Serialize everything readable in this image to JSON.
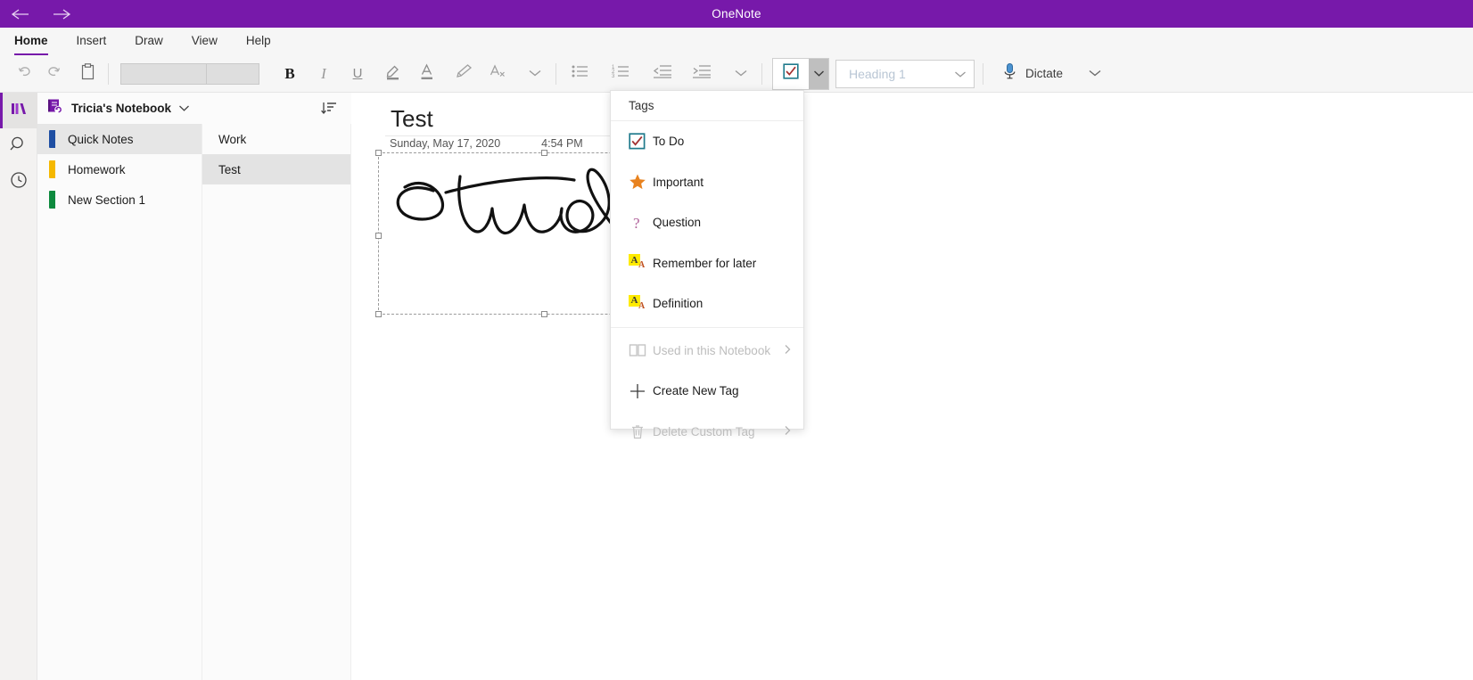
{
  "titlebar": {
    "app_title": "OneNote",
    "back_icon": "back-arrow-icon",
    "forward_icon": "forward-arrow-icon",
    "background": "#7719aa"
  },
  "ribbon": {
    "tabs": [
      {
        "label": "Home",
        "active": true
      },
      {
        "label": "Insert",
        "active": false
      },
      {
        "label": "Draw",
        "active": false
      },
      {
        "label": "View",
        "active": false
      },
      {
        "label": "Help",
        "active": false
      }
    ],
    "accent": "#7719aa"
  },
  "toolbar": {
    "undo_icon": "undo-icon",
    "redo_icon": "redo-icon",
    "clipboard_icon": "clipboard-icon",
    "font_name": "",
    "font_size": "",
    "bold_label": "B",
    "italic_label": "I",
    "underline_label": "U",
    "highlight_icon": "highlight-pen-icon",
    "font_color_icon": "font-color-icon",
    "format_painter_icon": "format-painter-icon",
    "clear_formatting_icon": "clear-formatting-icon",
    "more_font_icon": "chevron-down-icon",
    "bullets_icon": "bulleted-list-icon",
    "numbering_icon": "numbered-list-icon",
    "decrease_indent_icon": "decrease-indent-icon",
    "increase_indent_icon": "increase-indent-icon",
    "more_paragraph_icon": "chevron-down-icon",
    "todo_tag_icon": "todo-checkbox-icon",
    "todo_caret_icon": "chevron-down-icon",
    "style_value": "Heading 1",
    "style_caret_icon": "chevron-down-icon",
    "dictate_label": "Dictate",
    "dictate_icon": "microphone-icon",
    "dictate_caret_icon": "chevron-down-icon"
  },
  "rail": {
    "items": [
      {
        "name": "notebooks",
        "icon": "notebooks-icon",
        "active": true
      },
      {
        "name": "search",
        "icon": "search-icon",
        "active": false
      },
      {
        "name": "recent",
        "icon": "clock-icon",
        "active": false
      }
    ]
  },
  "notebook": {
    "name": "Tricia's Notebook",
    "icon": "notebook-sync-icon",
    "caret_icon": "chevron-down-icon",
    "sort_icon": "sort-icon"
  },
  "sections": [
    {
      "label": "Quick Notes",
      "color": "#1f4fa3",
      "selected": true
    },
    {
      "label": "Homework",
      "color": "#f5b800",
      "selected": false
    },
    {
      "label": "New Section 1",
      "color": "#0d8a3e",
      "selected": false
    }
  ],
  "pages": [
    {
      "label": "Work",
      "selected": false
    },
    {
      "label": "Test",
      "selected": true
    }
  ],
  "page": {
    "title": "Test",
    "date": "Sunday, May 17, 2020",
    "time": "4:54 PM",
    "ink_alt": "handwritten-ink-stud"
  },
  "tags_menu": {
    "header": "Tags",
    "items": [
      {
        "label": "To Do",
        "icon": "todo-checkbox-icon",
        "disabled": false,
        "submenu": false
      },
      {
        "label": "Important",
        "icon": "star-icon",
        "disabled": false,
        "submenu": false
      },
      {
        "label": "Question",
        "icon": "question-mark-icon",
        "disabled": false,
        "submenu": false
      },
      {
        "label": "Remember for later",
        "icon": "highlight-a-icon",
        "disabled": false,
        "submenu": false
      },
      {
        "label": "Definition",
        "icon": "highlight-a-icon",
        "disabled": false,
        "submenu": false
      },
      {
        "label": "Used in this Notebook",
        "icon": "book-icon",
        "disabled": true,
        "submenu": true
      },
      {
        "label": "Create New Tag",
        "icon": "plus-icon",
        "disabled": false,
        "submenu": false
      },
      {
        "label": "Delete Custom Tag",
        "icon": "trash-icon",
        "disabled": true,
        "submenu": true
      }
    ],
    "colors": {
      "checkbox_border": "#1f7a8c",
      "check_mark": "#a33131",
      "star": "#e8821e",
      "question": "#b0629b",
      "highlight": "#ffeb00"
    }
  }
}
